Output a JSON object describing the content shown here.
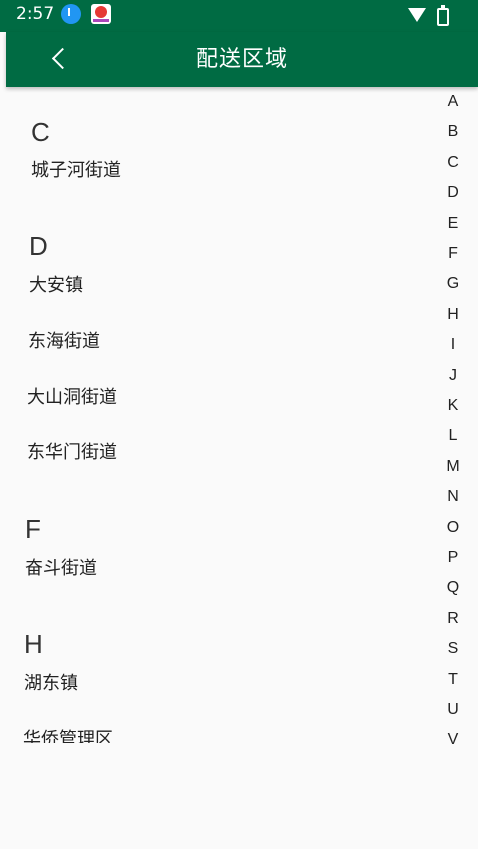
{
  "status": {
    "time": "2:57"
  },
  "header": {
    "title": "配送区域"
  },
  "groups": {
    "c": {
      "letter": "C",
      "items": [
        "城子河街道"
      ]
    },
    "d": {
      "letter": "D",
      "items": [
        "大安镇",
        "东海街道",
        "大山洞街道",
        "东华门街道"
      ]
    },
    "f": {
      "letter": "F",
      "items": [
        "奋斗街道"
      ]
    },
    "h": {
      "letter": "H",
      "items": [
        "湖东镇",
        "华侨管理区"
      ]
    }
  },
  "index_letters": [
    "A",
    "B",
    "C",
    "D",
    "E",
    "F",
    "G",
    "H",
    "I",
    "J",
    "K",
    "L",
    "M",
    "N",
    "O",
    "P",
    "Q",
    "R",
    "S",
    "T",
    "U",
    "V"
  ],
  "colors": {
    "appbar": "#006b43",
    "background": "#fafafa"
  }
}
